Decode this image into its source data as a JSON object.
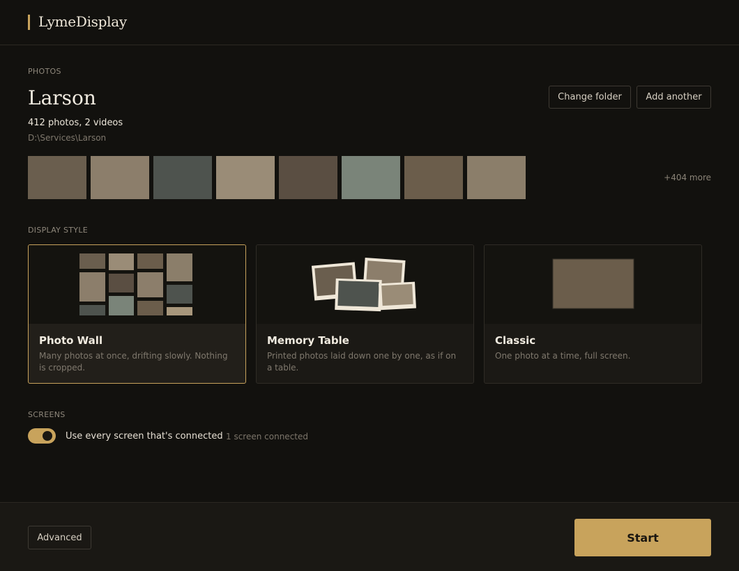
{
  "app": {
    "name": "LymeDisplay"
  },
  "photos": {
    "section_label": "PHOTOS",
    "title": "Larson",
    "counts": "412 photos, 2 videos",
    "path": "D:\\Services\\Larson",
    "change_folder_label": "Change folder",
    "add_another_label": "Add another",
    "more_label": "+404 more",
    "thumbnails": [
      "#6a5e4e",
      "#8c7e6b",
      "#4e534e",
      "#9a8c77",
      "#5a4e42",
      "#7a8479",
      "#6b5d4b",
      "#8b7e6a"
    ]
  },
  "display_style": {
    "section_label": "DISPLAY STYLE",
    "options": [
      {
        "title": "Photo Wall",
        "description": "Many photos at once, drifting slowly. Nothing is cropped.",
        "selected": true
      },
      {
        "title": "Memory Table",
        "description": "Printed photos laid down one by one, as if on a table.",
        "selected": false
      },
      {
        "title": "Classic",
        "description": "One photo at a time, full screen.",
        "selected": false
      }
    ]
  },
  "screens": {
    "section_label": "SCREENS",
    "toggle_label": "Use every screen that's connected",
    "toggle_on": true,
    "status": "1 screen connected"
  },
  "footer": {
    "advanced_label": "Advanced",
    "start_label": "Start"
  },
  "colors": {
    "accent": "#c8a35c",
    "background": "#12110e"
  }
}
